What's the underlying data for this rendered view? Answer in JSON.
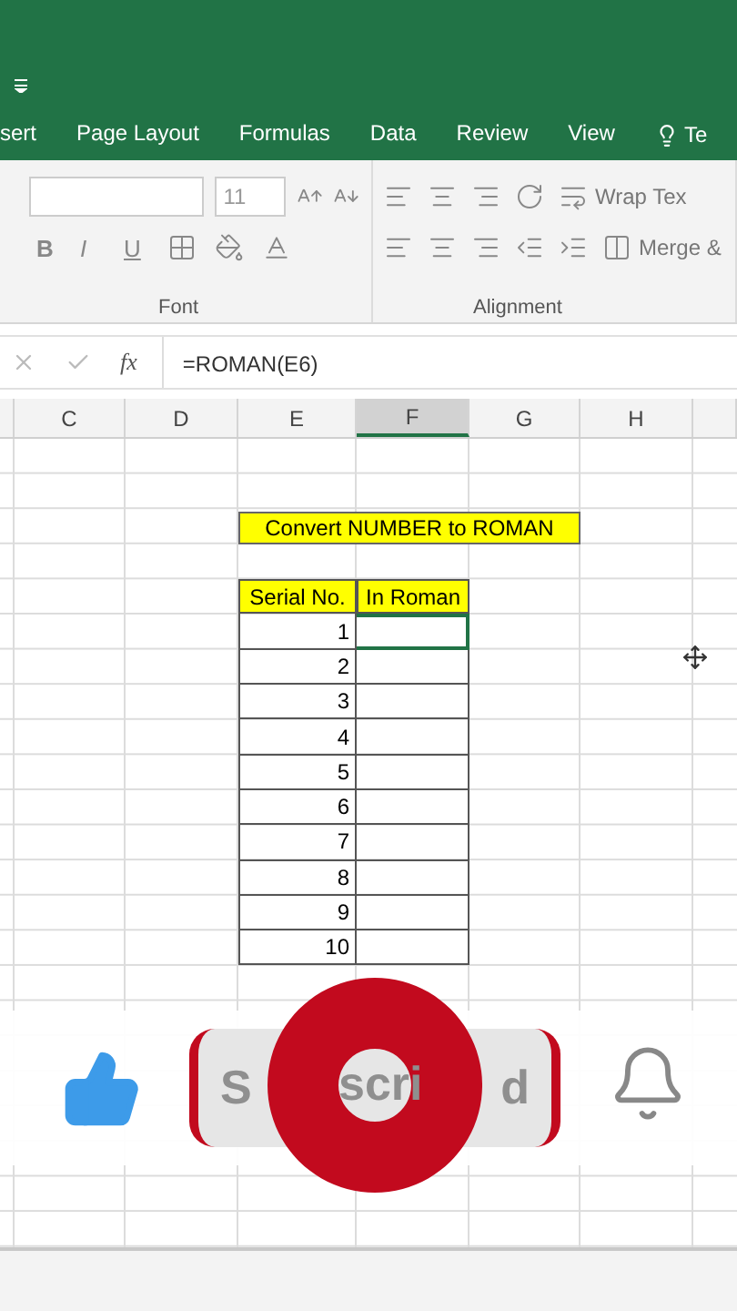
{
  "ribbon": {
    "tabs": [
      {
        "label": "sert",
        "selected": false
      },
      {
        "label": "Page Layout",
        "selected": false
      },
      {
        "label": "Formulas",
        "selected": false
      },
      {
        "label": "Data",
        "selected": false
      },
      {
        "label": "Review",
        "selected": false
      },
      {
        "label": "View",
        "selected": false
      }
    ],
    "tell_me": "Te",
    "font_size": "11",
    "font_buttons": [
      "B",
      "I",
      "U"
    ],
    "groups": [
      "Font",
      "Alignment"
    ],
    "wrap_text": "Wrap Tex",
    "merge": "Merge &"
  },
  "formula_bar": {
    "function_label": "fx",
    "value": "=ROMAN(E6)"
  },
  "columns": [
    {
      "label": "C",
      "selected": false
    },
    {
      "label": "D",
      "selected": false
    },
    {
      "label": "E",
      "selected": false
    },
    {
      "label": "F",
      "selected": true
    },
    {
      "label": "G",
      "selected": false
    },
    {
      "label": "H",
      "selected": false
    }
  ],
  "sheet": {
    "title": "Convert NUMBER to ROMAN",
    "headers": [
      "Serial No.",
      "In Roman"
    ],
    "rows": [
      {
        "serial": "1",
        "selected": true
      },
      {
        "serial": "2",
        "selected": false
      },
      {
        "serial": "3",
        "selected": false
      },
      {
        "serial": "4",
        "selected": false
      },
      {
        "serial": "5",
        "selected": false
      },
      {
        "serial": "6",
        "selected": false
      },
      {
        "serial": "7",
        "selected": false
      },
      {
        "serial": "8",
        "selected": false
      },
      {
        "serial": "9",
        "selected": false
      },
      {
        "serial": "10",
        "selected": false
      }
    ]
  },
  "overlay": {
    "subscribe_fragments": [
      "S",
      "scri",
      "d"
    ]
  }
}
